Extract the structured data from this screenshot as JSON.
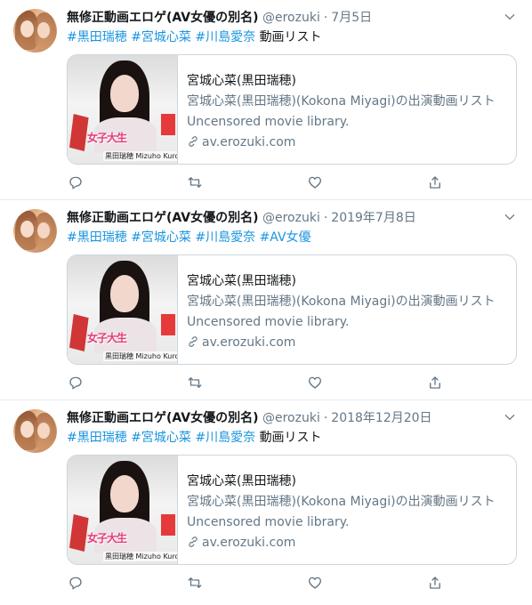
{
  "tweets": [
    {
      "name": "無修正動画エロゲ(AV女優の別名)",
      "handle": "@erozuki",
      "date": "7月5日",
      "hashtags": [
        "#黒田瑞穂",
        "#宮城心菜",
        "#川島愛奈"
      ],
      "text_tail": "動画リスト",
      "card": {
        "title": "宮城心菜(黒田瑞穂)",
        "description": "宮城心菜(黒田瑞穂)(Kokona Miyagi)の出演動画リスト",
        "subtitle": "Uncensored movie library.",
        "domain": "av.erozuki.com",
        "thumb_banner": "女子大生",
        "thumb_caption": "黒田瑞穂 Mizuho Kuroda"
      }
    },
    {
      "name": "無修正動画エロゲ(AV女優の別名)",
      "handle": "@erozuki",
      "date": "2019年7月8日",
      "hashtags": [
        "#黒田瑞穂",
        "#宮城心菜",
        "#川島愛奈",
        "#AV女優"
      ],
      "text_tail": "",
      "card": {
        "title": "宮城心菜(黒田瑞穂)",
        "description": "宮城心菜(黒田瑞穂)(Kokona Miyagi)の出演動画リスト",
        "subtitle": "Uncensored movie library.",
        "domain": "av.erozuki.com",
        "thumb_banner": "女子大生",
        "thumb_caption": "黒田瑞穂 Mizuho Kuroda"
      }
    },
    {
      "name": "無修正動画エロゲ(AV女優の別名)",
      "handle": "@erozuki",
      "date": "2018年12月20日",
      "hashtags": [
        "#黒田瑞穂",
        "#宮城心菜",
        "#川島愛奈"
      ],
      "text_tail": "動画リスト",
      "card": {
        "title": "宮城心菜(黒田瑞穂)",
        "description": "宮城心菜(黒田瑞穂)(Kokona Miyagi)の出演動画リスト",
        "subtitle": "Uncensored movie library.",
        "domain": "av.erozuki.com",
        "thumb_banner": "女子大生",
        "thumb_caption": "黒田瑞穂 Mizuho Kuroda"
      }
    }
  ],
  "separator": "·",
  "colors": {
    "link": "#1b95e0",
    "muted": "#657786",
    "border": "#ccd6dd",
    "text": "#14171a"
  },
  "icons": {
    "reply": "reply-icon",
    "retweet": "retweet-icon",
    "like": "like-icon",
    "share": "share-icon",
    "menu": "chevron-down-icon",
    "link": "link-icon"
  }
}
